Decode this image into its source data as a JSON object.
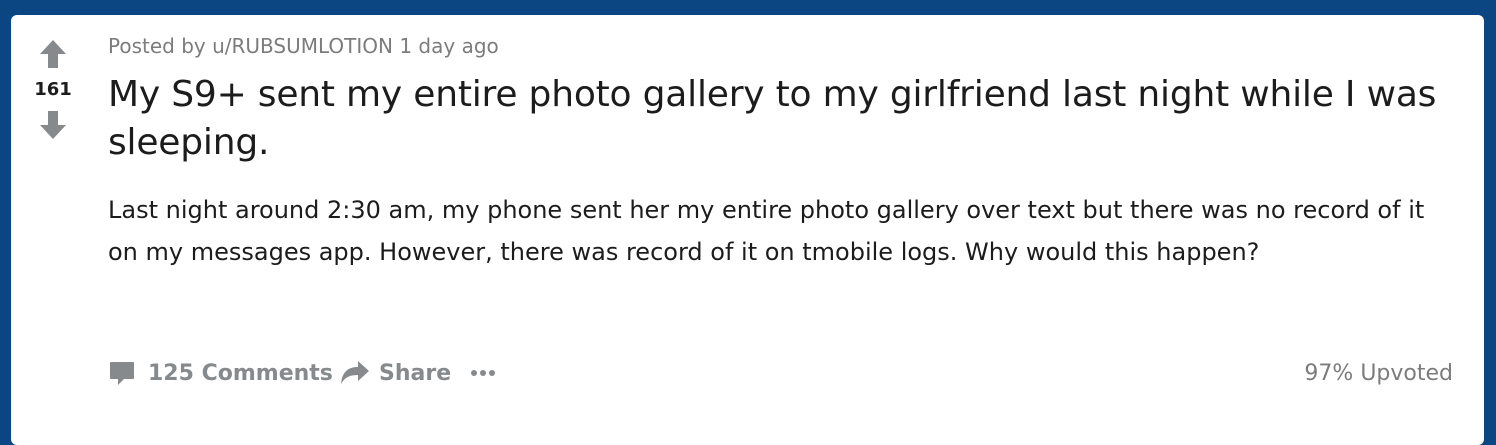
{
  "post": {
    "meta": "Posted by u/RUBSUMLOTION 1 day ago",
    "score": "161",
    "title": "My S9+ sent my entire photo gallery to my girlfriend last night while I was sleeping.",
    "body": "Last night around 2:30 am, my phone sent her my entire photo gallery over text but there was no record of it on my messages app. However, there was record of it on tmobile logs. Why would this happen?",
    "comments_label": "125 Comments",
    "share_label": "Share",
    "more_icon": "ellipsis-icon",
    "upvote_icon": "upvote-arrow-icon",
    "downvote_icon": "downvote-arrow-icon",
    "comment_icon": "comment-bubble-icon",
    "share_icon": "share-arrow-icon",
    "upvoted": "97% Upvoted"
  }
}
